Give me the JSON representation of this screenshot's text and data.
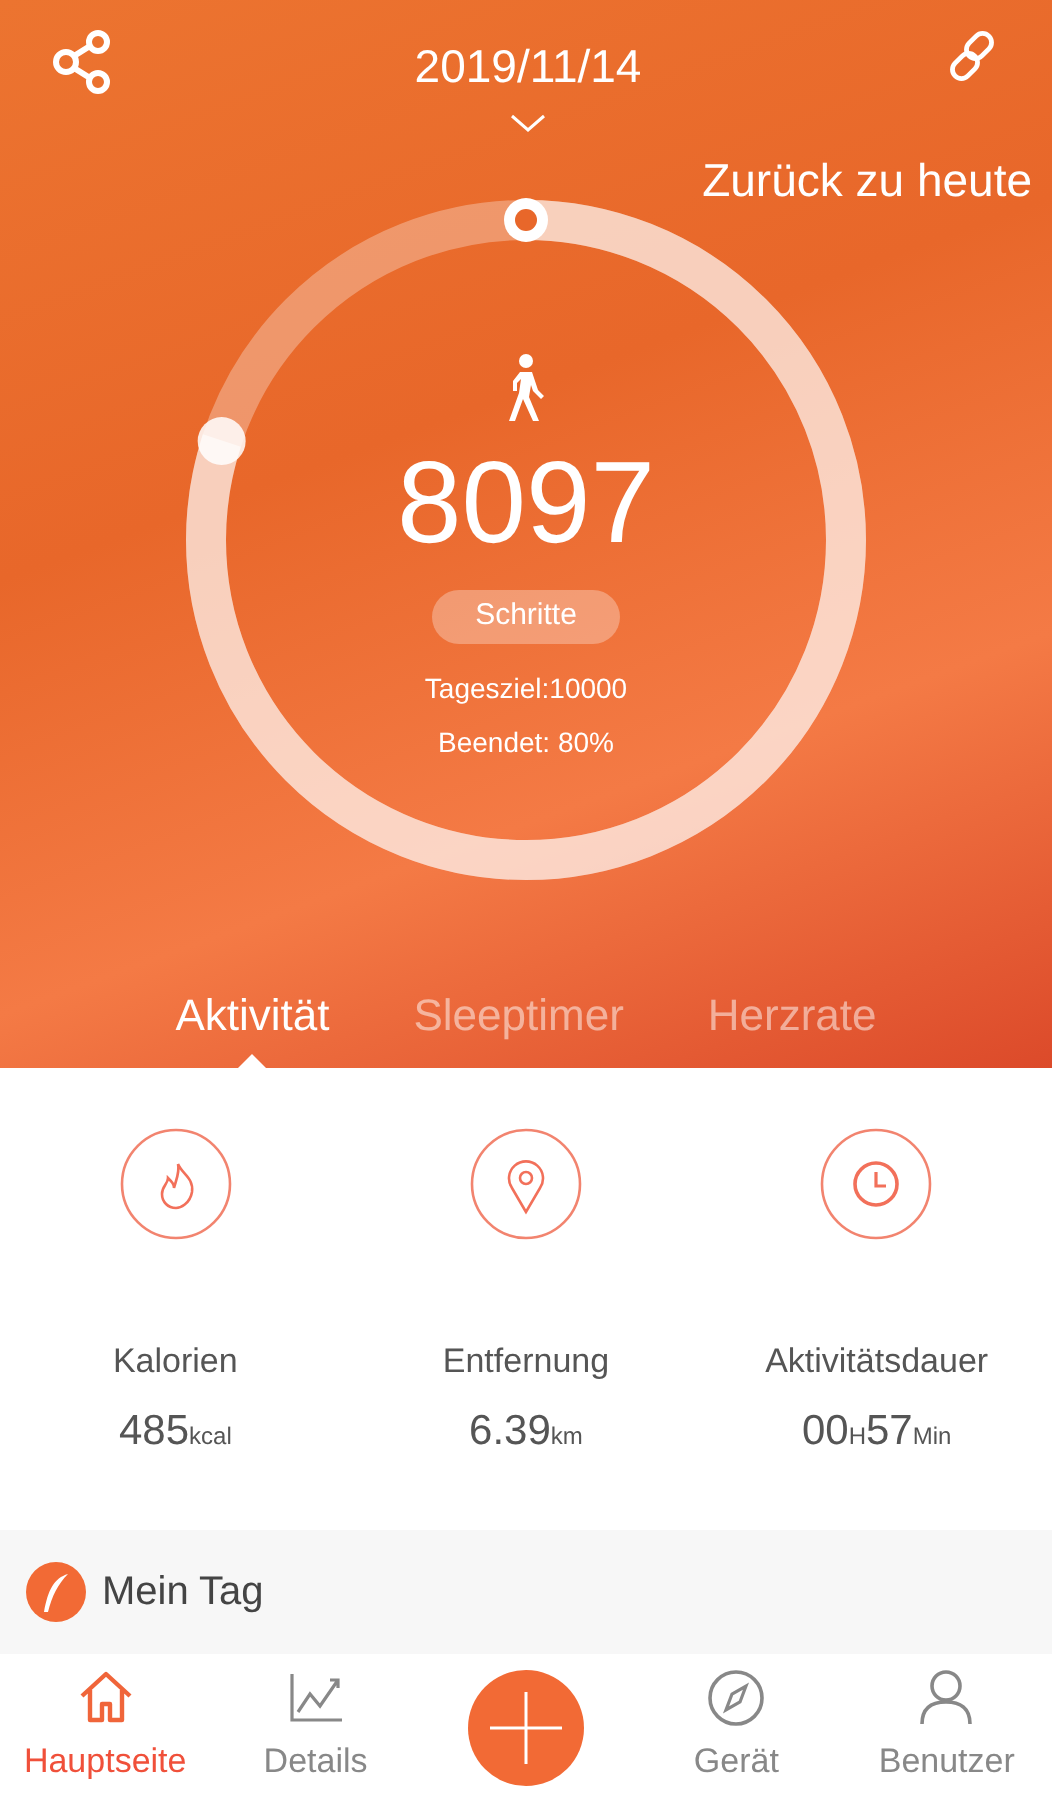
{
  "header": {
    "date": "2019/11/14",
    "back_to_today": "Zurück zu heute"
  },
  "ring": {
    "level": 0.8,
    "steps": "8097",
    "unit": "Schritte",
    "goal": "Tagesziel:10000",
    "done": "Beendet: 80%"
  },
  "tabs": [
    {
      "label": "Aktivität",
      "selected": true
    },
    {
      "label": "Sleeptimer",
      "selected": false
    },
    {
      "label": "Herzrate",
      "selected": false
    }
  ],
  "stats": [
    {
      "kind": "flame",
      "label": "Kalorien",
      "parts": [
        {
          "value": "485",
          "unit": "kcal"
        }
      ]
    },
    {
      "kind": "pin",
      "label": "Entfernung",
      "parts": [
        {
          "value": "6.39",
          "unit": "km"
        }
      ]
    },
    {
      "kind": "clock",
      "label": "Aktivitätsdauer",
      "parts": [
        {
          "value": "00",
          "unit": "H"
        },
        {
          "value": "57",
          "unit": "Min"
        }
      ]
    }
  ],
  "section": {
    "title": "Mein Tag"
  },
  "nav": [
    {
      "kind": "home",
      "label": "Hauptseite",
      "selected": true
    },
    {
      "kind": "chart",
      "label": "Details",
      "selected": false
    },
    {
      "kind": "plus",
      "selected": false
    },
    {
      "kind": "compass",
      "label": "Gerät",
      "selected": false
    },
    {
      "kind": "user",
      "label": "Benutzer",
      "selected": false
    }
  ]
}
